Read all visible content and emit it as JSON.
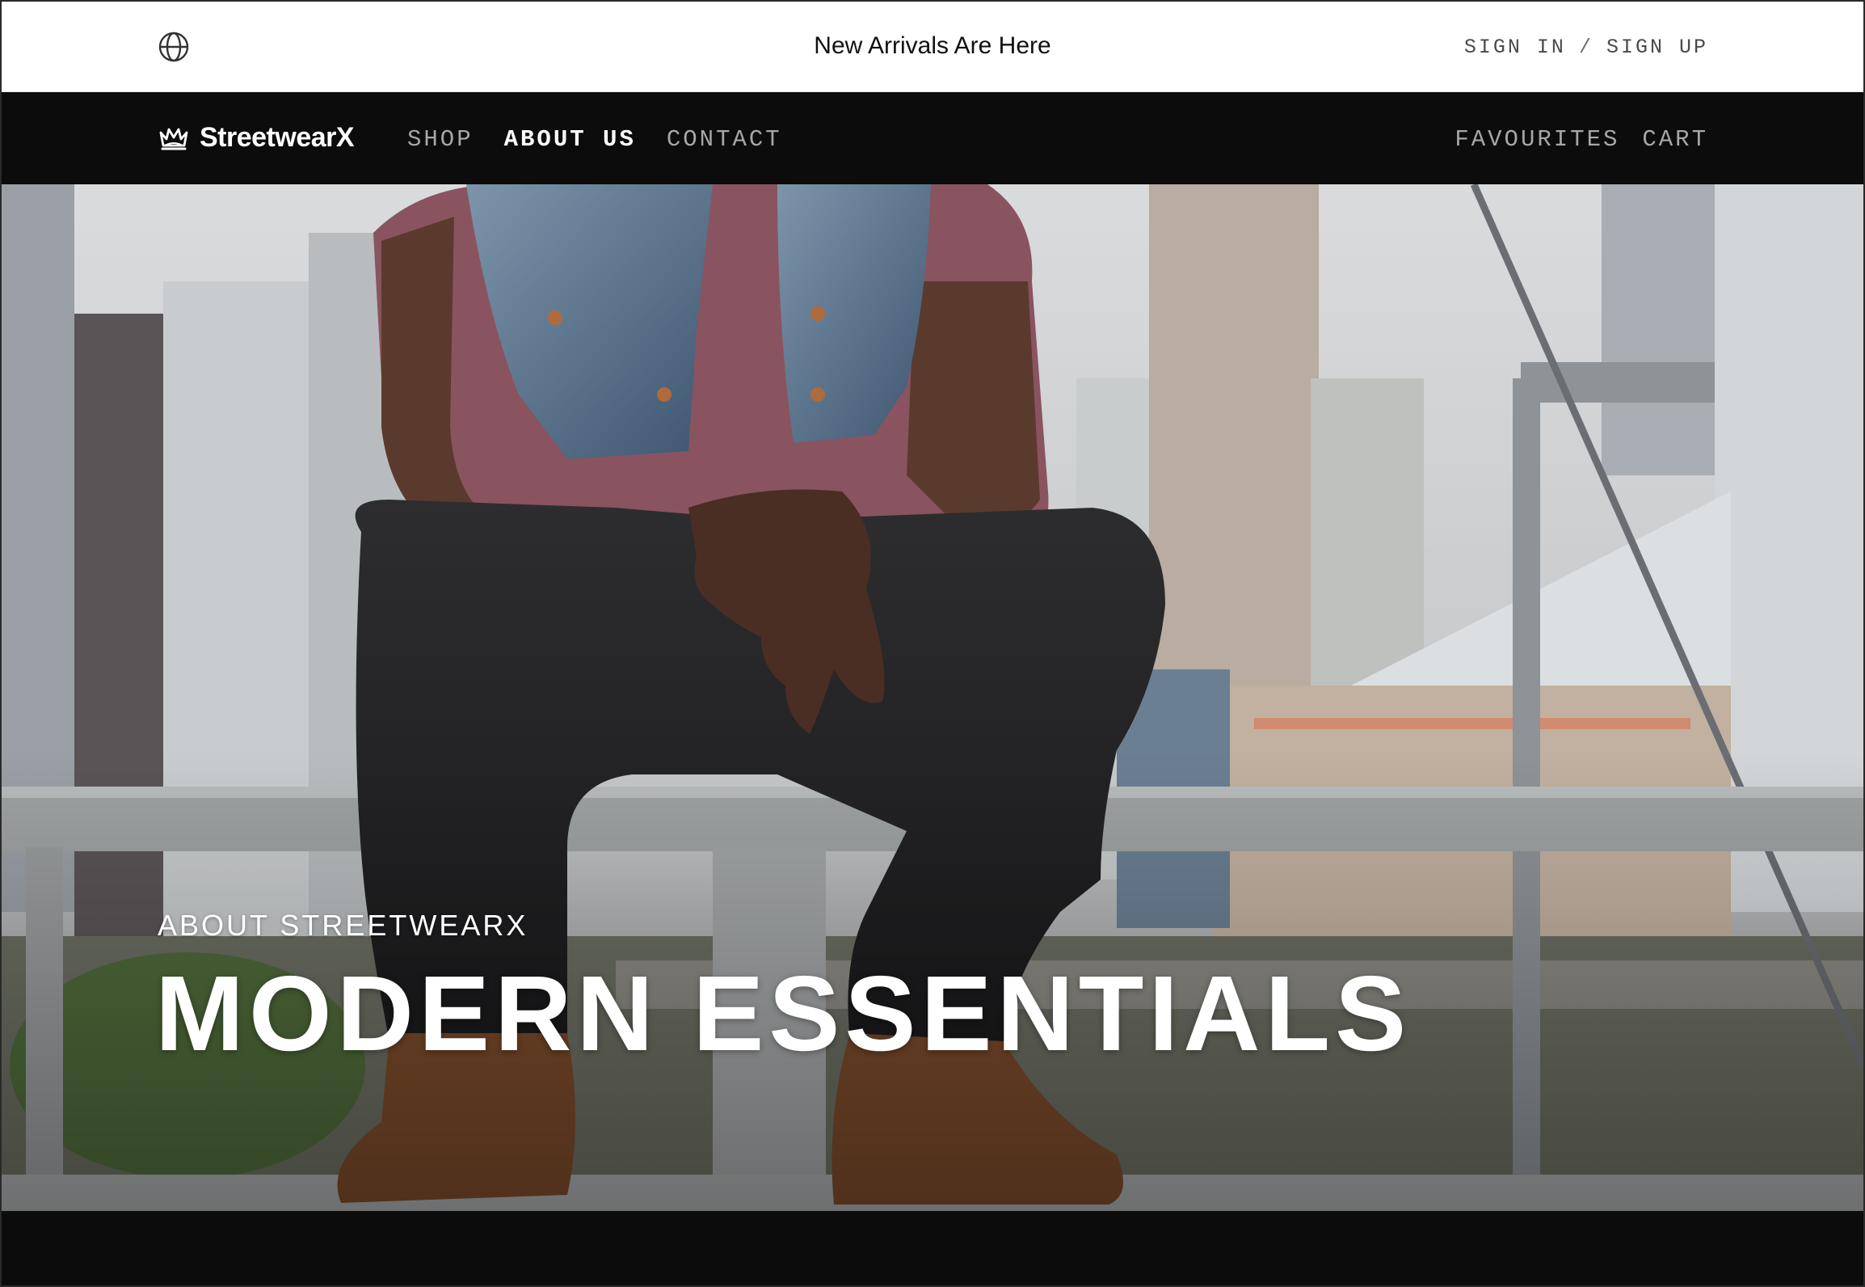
{
  "announcement": {
    "icon": "globe-icon",
    "text": "New Arrivals Are Here",
    "sign_in": "SIGN IN",
    "separator": "/",
    "sign_up": "SIGN UP"
  },
  "nav": {
    "logo_icon": "crown-icon",
    "brand": "StreetwearX",
    "links": [
      {
        "label": "SHOP",
        "active": false
      },
      {
        "label": "ABOUT US",
        "active": true
      },
      {
        "label": "CONTACT",
        "active": false
      }
    ],
    "right_links": [
      {
        "label": "FAVOURITES"
      },
      {
        "label": "CART"
      }
    ]
  },
  "hero": {
    "eyebrow": "ABOUT STREETWEARX",
    "title": "MODERN ESSENTIALS"
  },
  "colors": {
    "nav_background": "#0c0c0c",
    "announcement_background": "#ffffff",
    "active_link": "#ffffff",
    "inactive_link": "#a7a7a7"
  }
}
